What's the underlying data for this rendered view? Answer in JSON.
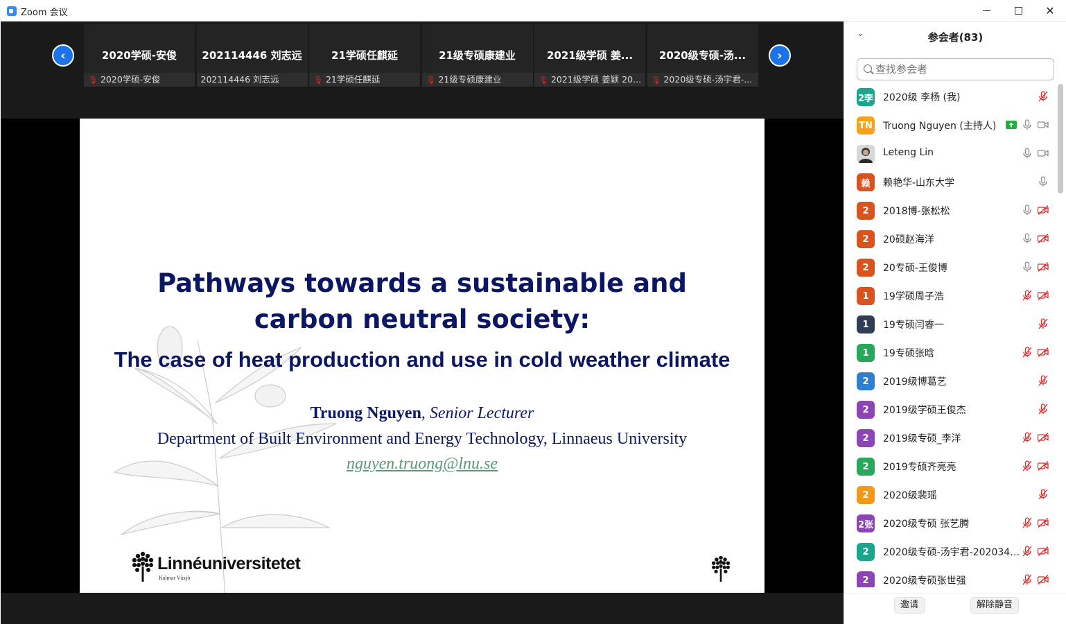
{
  "window": {
    "title": "Zoom 会议"
  },
  "strip": {
    "tiles": [
      {
        "name": "2020学硕-安俊",
        "label": "2020学硕-安俊",
        "muted": true
      },
      {
        "name": "202114446 刘志远",
        "label": "202114446 刘志远",
        "muted": false
      },
      {
        "name": "21学硕任麒延",
        "label": "21学硕任麒延",
        "muted": true
      },
      {
        "name": "21级专硕康建业",
        "label": "21级专硕康建业",
        "muted": true
      },
      {
        "name": "2021级学硕 姜...",
        "label": "2021级学硕 姜颖 20...",
        "muted": true
      },
      {
        "name": "2020级专硕-汤...",
        "label": "2020级专硕-汤宇君-...",
        "muted": true
      }
    ]
  },
  "slide": {
    "title_line1": "Pathways towards a sustainable and",
    "title_line2": "carbon neutral society:",
    "subtitle": "The case of heat production and use in cold weather climate",
    "author_name": "Truong Nguyen",
    "author_sep": ", ",
    "author_role": "Senior Lecturer",
    "department": "Department of Built Environment and Energy Technology, Linnaeus University",
    "email": "nguyen.truong@lnu.se",
    "logo_text": "Linnéuniversitetet",
    "logo_sub": "Kalmar Växjö"
  },
  "panel": {
    "title": "参会者(83)",
    "search_placeholder": "查找参会者",
    "invite_label": "邀请",
    "unmute_label": "解除静音",
    "participants": [
      {
        "avatar": "2李",
        "color": "#1aa68d",
        "name": "2020级 李杨 (我)",
        "mic": "off",
        "video": "none",
        "share": false
      },
      {
        "avatar": "TN",
        "color": "#f7a21b",
        "name": "Truong Nguyen (主持人)",
        "mic": "on",
        "video": "on",
        "share": true
      },
      {
        "avatar": "",
        "color": "#666666",
        "name": "Leteng Lin",
        "mic": "on",
        "video": "on",
        "share": false,
        "photo": true
      },
      {
        "avatar": "赖",
        "color": "#d9531e",
        "name": "赖艳华-山东大学",
        "mic": "on",
        "video": "none",
        "share": false
      },
      {
        "avatar": "2",
        "color": "#d9531e",
        "name": "2018博-张松松",
        "mic": "on",
        "video": "off",
        "share": false
      },
      {
        "avatar": "2",
        "color": "#d9531e",
        "name": "20硕赵海洋",
        "mic": "on",
        "video": "off",
        "share": false
      },
      {
        "avatar": "2",
        "color": "#d9531e",
        "name": "20专硕-王俊博",
        "mic": "on",
        "video": "off",
        "share": false
      },
      {
        "avatar": "1",
        "color": "#d9531e",
        "name": "19学硕周子浩",
        "mic": "off",
        "video": "off",
        "share": false
      },
      {
        "avatar": "1",
        "color": "#2f3e55",
        "name": "19专硕闫睿一",
        "mic": "off",
        "video": "none",
        "share": false
      },
      {
        "avatar": "1",
        "color": "#27a85a",
        "name": "19专硕张晗",
        "mic": "off",
        "video": "off",
        "share": false
      },
      {
        "avatar": "2",
        "color": "#2d7fd0",
        "name": "2019级博葛艺",
        "mic": "off",
        "video": "none",
        "share": false
      },
      {
        "avatar": "2",
        "color": "#8d44b5",
        "name": "2019级学硕王俊杰",
        "mic": "off",
        "video": "none",
        "share": false
      },
      {
        "avatar": "2",
        "color": "#8d44b5",
        "name": "2019级专硕_李洋",
        "mic": "off",
        "video": "off",
        "share": false
      },
      {
        "avatar": "2",
        "color": "#27a85a",
        "name": "2019专硕齐亮亮",
        "mic": "off",
        "video": "off",
        "share": false
      },
      {
        "avatar": "2",
        "color": "#f29a18",
        "name": "2020级裴瑶",
        "mic": "off",
        "video": "none",
        "share": false
      },
      {
        "avatar": "2张",
        "color": "#8d44b5",
        "name": "2020级专硕 张艺腾",
        "mic": "off",
        "video": "off",
        "share": false
      },
      {
        "avatar": "2",
        "color": "#1aa68d",
        "name": "2020级专硕-汤宇君-2020345...",
        "mic": "off",
        "video": "off",
        "share": false
      },
      {
        "avatar": "2",
        "color": "#8d44b5",
        "name": "2020级专硕张世强",
        "mic": "off",
        "video": "off",
        "share": false
      }
    ]
  }
}
